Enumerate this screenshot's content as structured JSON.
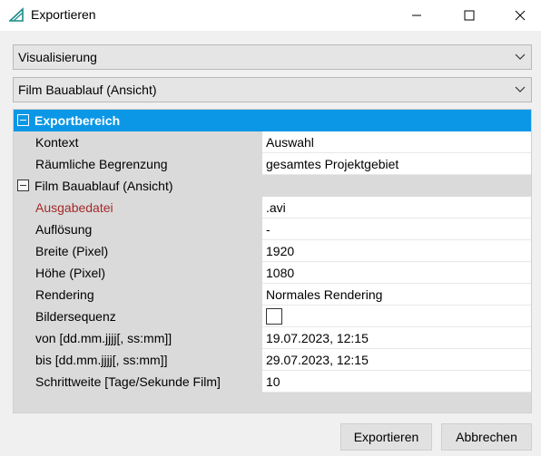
{
  "window": {
    "title": "Exportieren",
    "accent": "#0b97e6"
  },
  "combos": {
    "category": "Visualisierung",
    "item": "Film Bauablauf (Ansicht)"
  },
  "grid": {
    "section1": {
      "label": "Exportbereich",
      "rows": [
        {
          "name": "Kontext",
          "value": "Auswahl"
        },
        {
          "name": "Räumliche Begrenzung",
          "value": "gesamtes Projektgebiet"
        }
      ]
    },
    "section2": {
      "label": "Film Bauablauf (Ansicht)",
      "rows": [
        {
          "name": "Ausgabedatei",
          "value": ".avi"
        },
        {
          "name": "Auflösung",
          "value": "-"
        },
        {
          "name": "Breite (Pixel)",
          "value": "1920"
        },
        {
          "name": "Höhe (Pixel)",
          "value": "1080"
        },
        {
          "name": "Rendering",
          "value": "Normales Rendering"
        },
        {
          "name": "Bildersequenz",
          "checked": false
        },
        {
          "name": "von [dd.mm.jjjj[, ss:mm]]",
          "value": "19.07.2023, 12:15"
        },
        {
          "name": "bis [dd.mm.jjjj[, ss:mm]]",
          "value": "29.07.2023, 12:15"
        },
        {
          "name": "Schrittweite [Tage/Sekunde Film]",
          "value": "10"
        }
      ]
    }
  },
  "buttons": {
    "export": "Exportieren",
    "cancel": "Abbrechen"
  }
}
